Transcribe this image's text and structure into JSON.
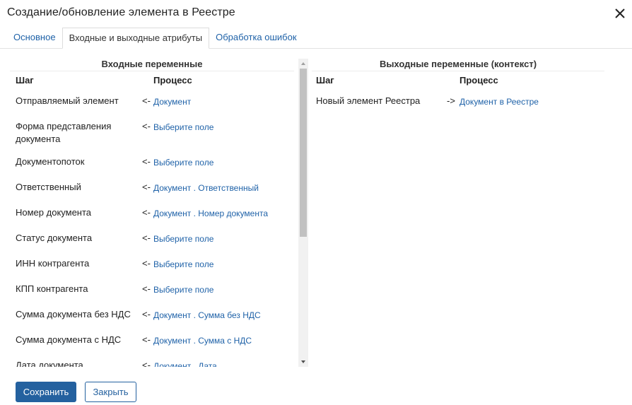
{
  "dialog": {
    "title": "Создание/обновление элемента в Реестре"
  },
  "tabs": [
    {
      "label": "Основное"
    },
    {
      "label": "Входные и выходные атрибуты"
    },
    {
      "label": "Обработка ошибок"
    }
  ],
  "input_vars": {
    "title": "Входные переменные",
    "col_step": "Шаг",
    "col_process": "Процесс",
    "arrow": "<-",
    "rows": [
      {
        "step": "Отправляемый элемент",
        "value": "Документ"
      },
      {
        "step": "Форма представления документа",
        "value": "Выберите поле"
      },
      {
        "step": "Документопоток",
        "value": "Выберите поле"
      },
      {
        "step": "Ответственный",
        "value": "Документ . Ответственный"
      },
      {
        "step": "Номер документа",
        "value": "Документ . Номер документа"
      },
      {
        "step": "Статус документа",
        "value": "Выберите поле"
      },
      {
        "step": "ИНН контрагента",
        "value": "Выберите поле"
      },
      {
        "step": "КПП контрагента",
        "value": "Выберите поле"
      },
      {
        "step": "Сумма документа без НДС",
        "value": "Документ . Сумма без НДС"
      },
      {
        "step": "Сумма документа с НДС",
        "value": "Документ . Сумма с НДС"
      },
      {
        "step": "Дата документа",
        "value": "Документ . Дата"
      }
    ]
  },
  "output_vars": {
    "title": "Выходные переменные (контекст)",
    "col_step": "Шаг",
    "col_process": "Процесс",
    "arrow": "->",
    "rows": [
      {
        "step": "Новый элемент Реестра",
        "value": "Документ в Реестре"
      }
    ]
  },
  "footer": {
    "save_label": "Сохранить",
    "close_label": "Закрыть"
  },
  "colors": {
    "link": "#1f62a8",
    "primary": "#24619f"
  }
}
